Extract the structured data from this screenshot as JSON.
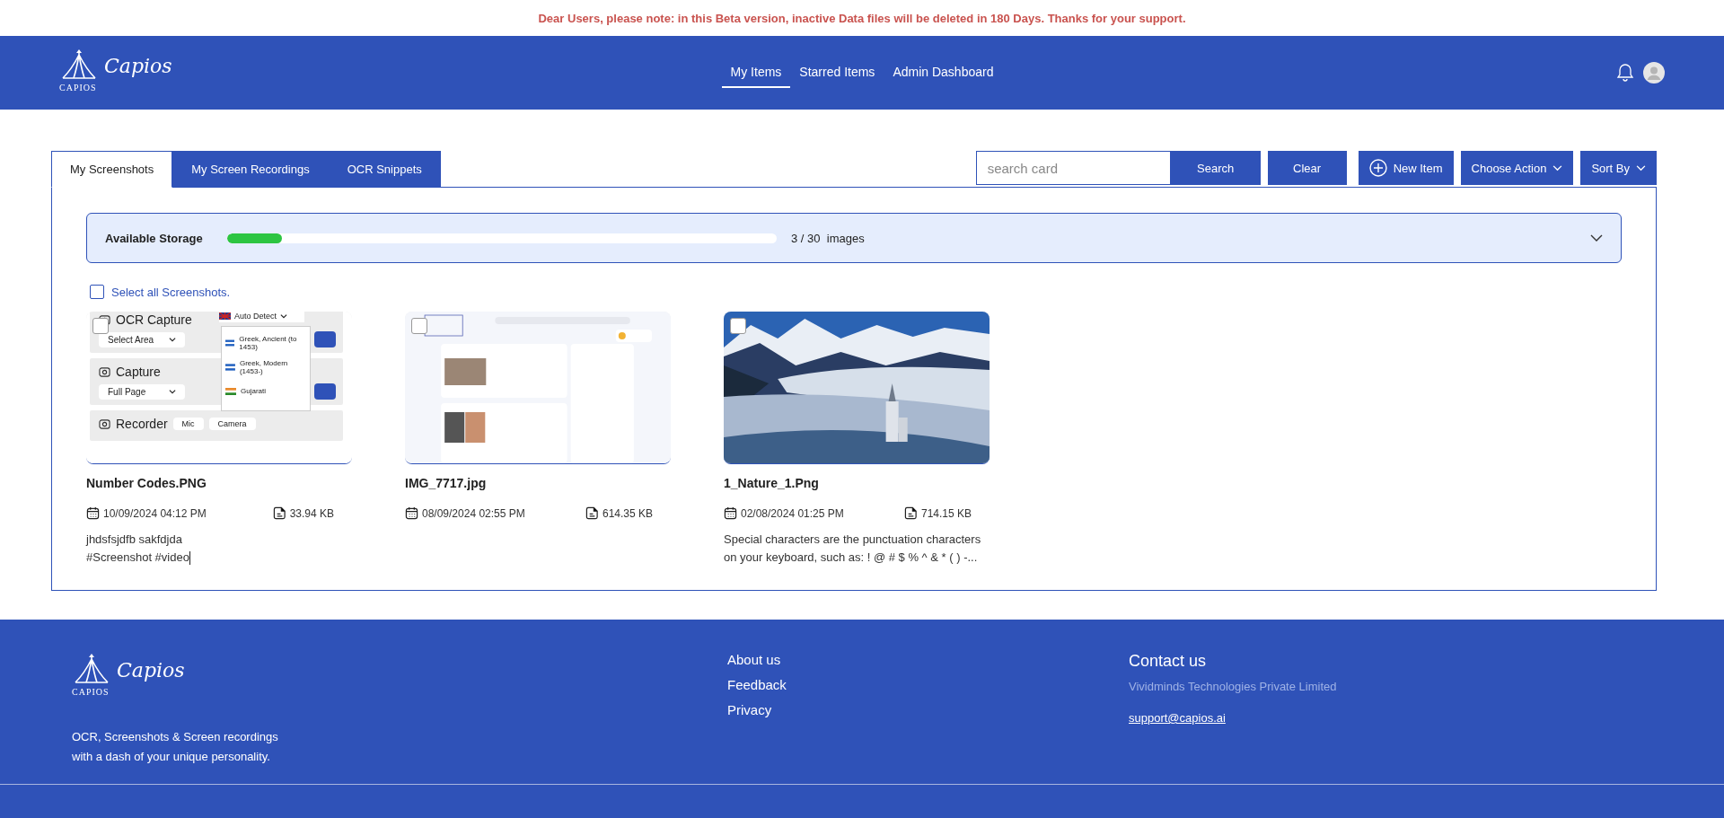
{
  "banner": "Dear Users, please note: in this Beta version, inactive Data files will be deleted in 180 Days. Thanks for your support.",
  "header": {
    "logo_script": "Capios",
    "logo_caps": "CAPIOS",
    "nav": [
      {
        "label": "My Items",
        "selected": true
      },
      {
        "label": "Starred Items",
        "selected": false
      },
      {
        "label": "Admin Dashboard",
        "selected": false
      }
    ]
  },
  "tabs": [
    {
      "label": "My Screenshots",
      "selected": true
    },
    {
      "label": "My Screen Recordings",
      "selected": false
    },
    {
      "label": "OCR Snippets",
      "selected": false
    }
  ],
  "search": {
    "placeholder": "search card"
  },
  "buttons": [
    {
      "kind": "plain",
      "label": "Search"
    },
    {
      "kind": "plain",
      "label": "Clear"
    },
    {
      "kind": "add",
      "label": "New Item"
    },
    {
      "kind": "dropdown",
      "label": "Choose Action"
    },
    {
      "kind": "dropdown",
      "label": "Sort By"
    }
  ],
  "storage": {
    "label": "Available Storage",
    "level": 0.1,
    "reading": "3 / 30  images"
  },
  "select_all": {
    "label": "Select all Screenshots.",
    "checked": false
  },
  "cards": [
    {
      "kind": "app-screenshot",
      "checked": false,
      "name": "Number Codes.PNG",
      "date": "10/09/2024 04:12 PM",
      "size": "33.94 KB",
      "description": "jhdsfsjdfb sakfdjda",
      "tags": "#Screenshot #video",
      "thumbnail": {
        "sections": [
          {
            "title": "OCR Capture",
            "control": "Select Area"
          },
          {
            "title": "Capture",
            "control": "Full Page"
          },
          {
            "title": "Recorder",
            "control": "Mic"
          }
        ],
        "camera": "Camera",
        "language": "Auto Detect",
        "options": [
          "Greek, Ancient (to 1453)",
          "Greek, Modern (1453-)",
          "Gujarati"
        ]
      }
    },
    {
      "kind": "web-screenshot",
      "checked": false,
      "name": "IMG_7717.jpg",
      "date": "08/09/2024 02:55 PM",
      "size": "614.35 KB"
    },
    {
      "checked": false,
      "name": "1_Nature_1.Png",
      "date": "02/08/2024 01:25 PM",
      "size": "714.15 KB",
      "description": "Special characters are the punctuation characters on your keyboard, such as: ! @ # $ % ^ & * ( ) -..."
    }
  ],
  "footer": {
    "logo_script": "Capios",
    "logo_caps": "CAPIOS",
    "tagline": "OCR, Screenshots & Screen recordings with a dash of your unique personality.",
    "links": [
      "About us",
      "Feedback",
      "Privacy"
    ],
    "contact": {
      "title": "Contact us",
      "company": "Vividminds Technologies Private Limited",
      "email": "support@capios.ai"
    }
  }
}
